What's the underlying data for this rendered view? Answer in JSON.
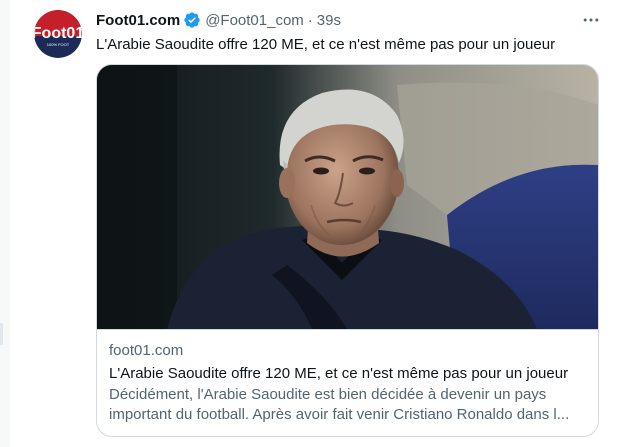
{
  "tweet": {
    "author": {
      "display_name": "Foot01.com",
      "handle": "@Foot01_com",
      "avatar_logo_text": "Foot01",
      "avatar_tagline": "100% FOOT",
      "verified_icon": "verified-badge-icon"
    },
    "separator": "·",
    "time": "39s",
    "text": "L'Arabie Saoudite offre 120 ME, et ce n'est même pas pour un joueur",
    "more_icon": "more-dots-icon"
  },
  "card": {
    "image_alt": "Photo of a grey-haired man in a dark jacket",
    "domain": "foot01.com",
    "title": "L'Arabie Saoudite offre 120 ME, et ce n'est même pas pour un joueur",
    "description": "Décidément, l'Arabie Saoudite est bien décidée à devenir un pays important du football. Après avoir fait venir Cristiano Ronaldo dans l..."
  },
  "colors": {
    "accent": "#1d9bf0",
    "text_primary": "#0f1419",
    "text_secondary": "#536471",
    "border": "#cfd9de"
  }
}
